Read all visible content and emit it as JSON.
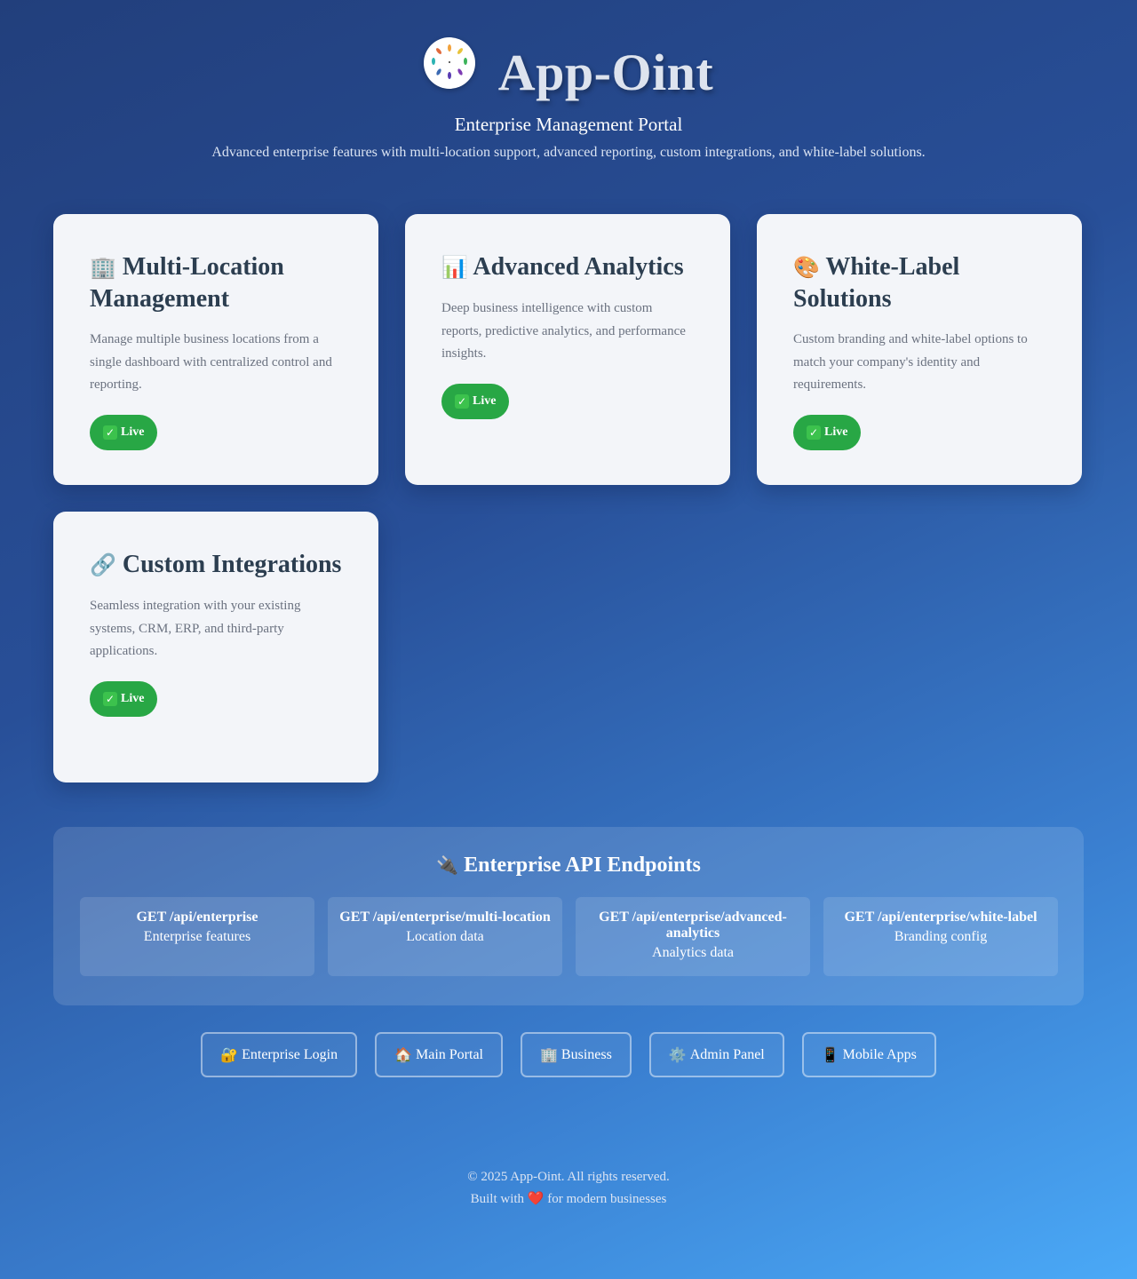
{
  "header": {
    "title": "App-Oint",
    "subtitle": "Enterprise Management Portal",
    "description": "Advanced enterprise features with multi-location support, advanced reporting, custom integrations, and white-label solutions."
  },
  "features": [
    {
      "icon": "🏢",
      "icon_name": "office-building-icon",
      "title": "Multi-Location Management",
      "text": "Manage multiple business locations from a single dashboard with centralized control and reporting.",
      "badge": "Live"
    },
    {
      "icon": "📊",
      "icon_name": "bar-chart-icon",
      "title": "Advanced Analytics",
      "text": "Deep business intelligence with custom reports, predictive analytics, and performance insights.",
      "badge": "Live"
    },
    {
      "icon": "🎨",
      "icon_name": "palette-icon",
      "title": "White-Label Solutions",
      "text": "Custom branding and white-label options to match your company's identity and requirements.",
      "badge": "Live"
    },
    {
      "icon": "🔗",
      "icon_name": "link-icon",
      "title": "Custom Integrations",
      "text": "Seamless integration with your existing systems, CRM, ERP, and third-party applications.",
      "badge": "Live"
    }
  ],
  "api": {
    "icon": "🔌",
    "title": "Enterprise API Endpoints",
    "endpoints": [
      {
        "path": "GET /api/enterprise",
        "desc": "Enterprise features"
      },
      {
        "path": "GET /api/enterprise/multi-location",
        "desc": "Location data"
      },
      {
        "path": "GET /api/enterprise/advanced-analytics",
        "desc": "Analytics data"
      },
      {
        "path": "GET /api/enterprise/white-label",
        "desc": "Branding config"
      }
    ]
  },
  "links": [
    {
      "icon": "🔐",
      "label": "Enterprise Login"
    },
    {
      "icon": "🏠",
      "label": "Main Portal"
    },
    {
      "icon": "🏢",
      "label": "Business"
    },
    {
      "icon": "⚙️",
      "label": "Admin Panel"
    },
    {
      "icon": "📱",
      "label": "Mobile Apps"
    }
  ],
  "footer": {
    "copyright": "© 2025 App-Oint. All rights reserved.",
    "built_prefix": "Built with",
    "heart": "❤️",
    "built_suffix": "for modern businesses"
  },
  "colors": {
    "accent_green": "#28a745",
    "card_title": "#2c3e50",
    "background_start": "#223f7c",
    "background_end": "#4aa9f7"
  }
}
